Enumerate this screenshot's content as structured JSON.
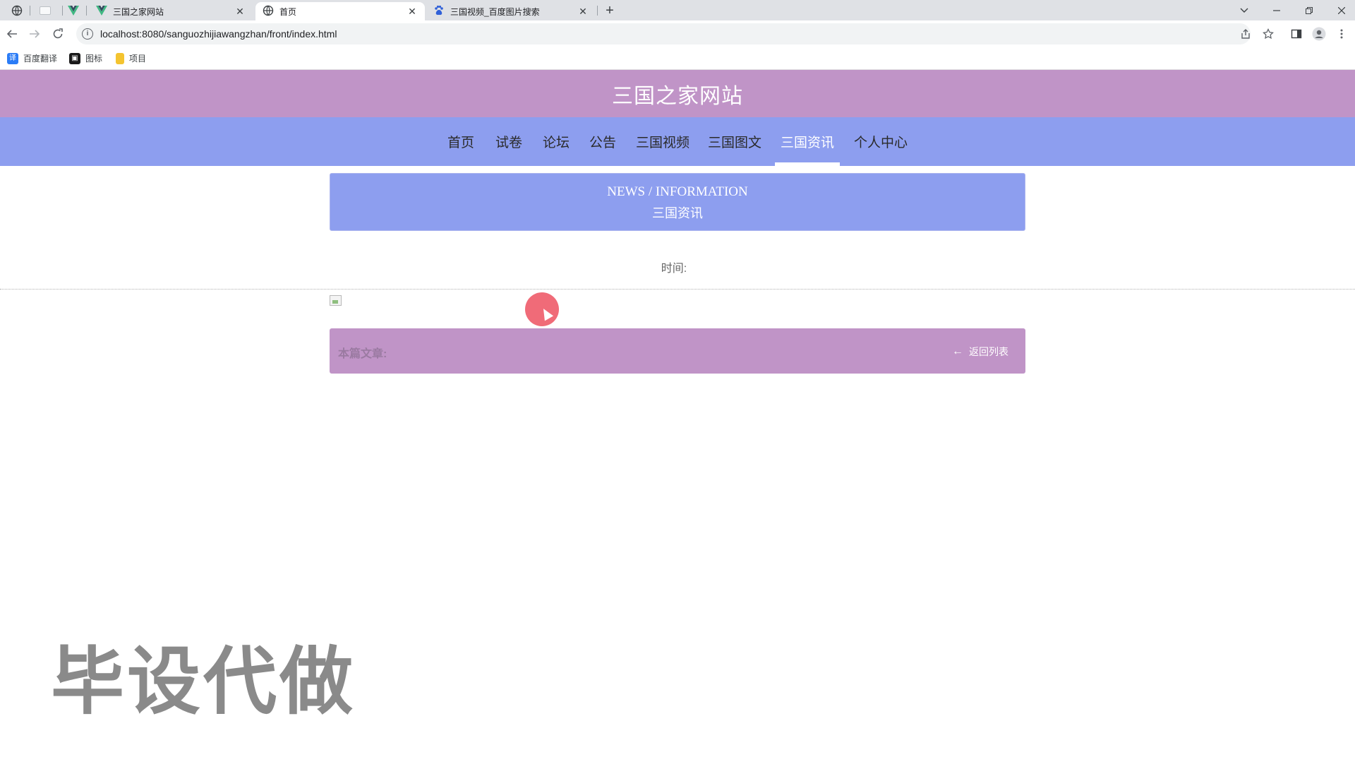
{
  "browser": {
    "tabs": [
      {
        "title": "三国之家网站",
        "active": false
      },
      {
        "title": "首页",
        "active": true
      },
      {
        "title": "三国视频_百度图片搜索",
        "active": false
      }
    ],
    "new_tab": "+",
    "url": "localhost:8080/sanguozhijiawangzhan/front/index.html",
    "bookmarks": [
      {
        "label": "百度翻译",
        "icon": "translate-icon",
        "color": "#2b7cf6"
      },
      {
        "label": "图标",
        "icon": "image-icon",
        "color": "#1a1a1a"
      },
      {
        "label": "项目",
        "icon": "folder-icon",
        "color": "#f4c430"
      }
    ]
  },
  "site": {
    "title": "三国之家网站",
    "nav": [
      "首页",
      "试卷",
      "论坛",
      "公告",
      "三国视频",
      "三国图文",
      "三国资讯",
      "个人中心"
    ],
    "active_nav": "三国资讯",
    "colors": {
      "header": "#c094c7",
      "nav": "#8d9eef"
    }
  },
  "banner": {
    "en": "NEWS / INFORMATION",
    "cn": "三国资讯"
  },
  "article": {
    "time_label": "时间:",
    "bar_label": "本篇文章:",
    "back_label": "返回列表"
  },
  "watermark": "毕设代做"
}
